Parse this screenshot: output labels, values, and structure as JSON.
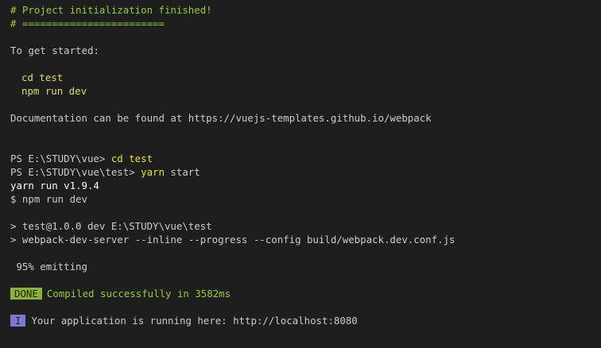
{
  "colors": {
    "background": "#1e1e1e",
    "text": "#cccccc",
    "comment": "#99cc33",
    "command_hint": "#dcdc6c",
    "typed_command": "#e5e510",
    "done_badge": "#8ab42d",
    "info_badge": "#7a7ad0"
  },
  "init": {
    "finished": "# Project initialization finished!",
    "divider": "# ========================",
    "get_started": "To get started:",
    "cmd1": "cd test",
    "cmd2": "npm run dev",
    "docs": "Documentation can be found at https://vuejs-templates.github.io/webpack"
  },
  "session": {
    "prompt1": "PS E:\\STUDY\\vue> ",
    "cmd1": "cd test",
    "prompt2": "PS E:\\STUDY\\vue\\test> ",
    "cmd2_bin": "yarn",
    "cmd2_arg": " start",
    "yarn_version": "yarn run v1.9.4",
    "npm_cmd": "$ npm run dev",
    "script_line1": "> test@1.0.0 dev E:\\STUDY\\vue\\test",
    "script_line2": "> webpack-dev-server --inline --progress --config build/webpack.dev.conf.js",
    "progress": " 95% emitting",
    "done_badge": "DONE",
    "compiled": "Compiled successfully in 3582ms",
    "info_badge": "I",
    "running": "Your application is running here: http://localhost:8080"
  }
}
